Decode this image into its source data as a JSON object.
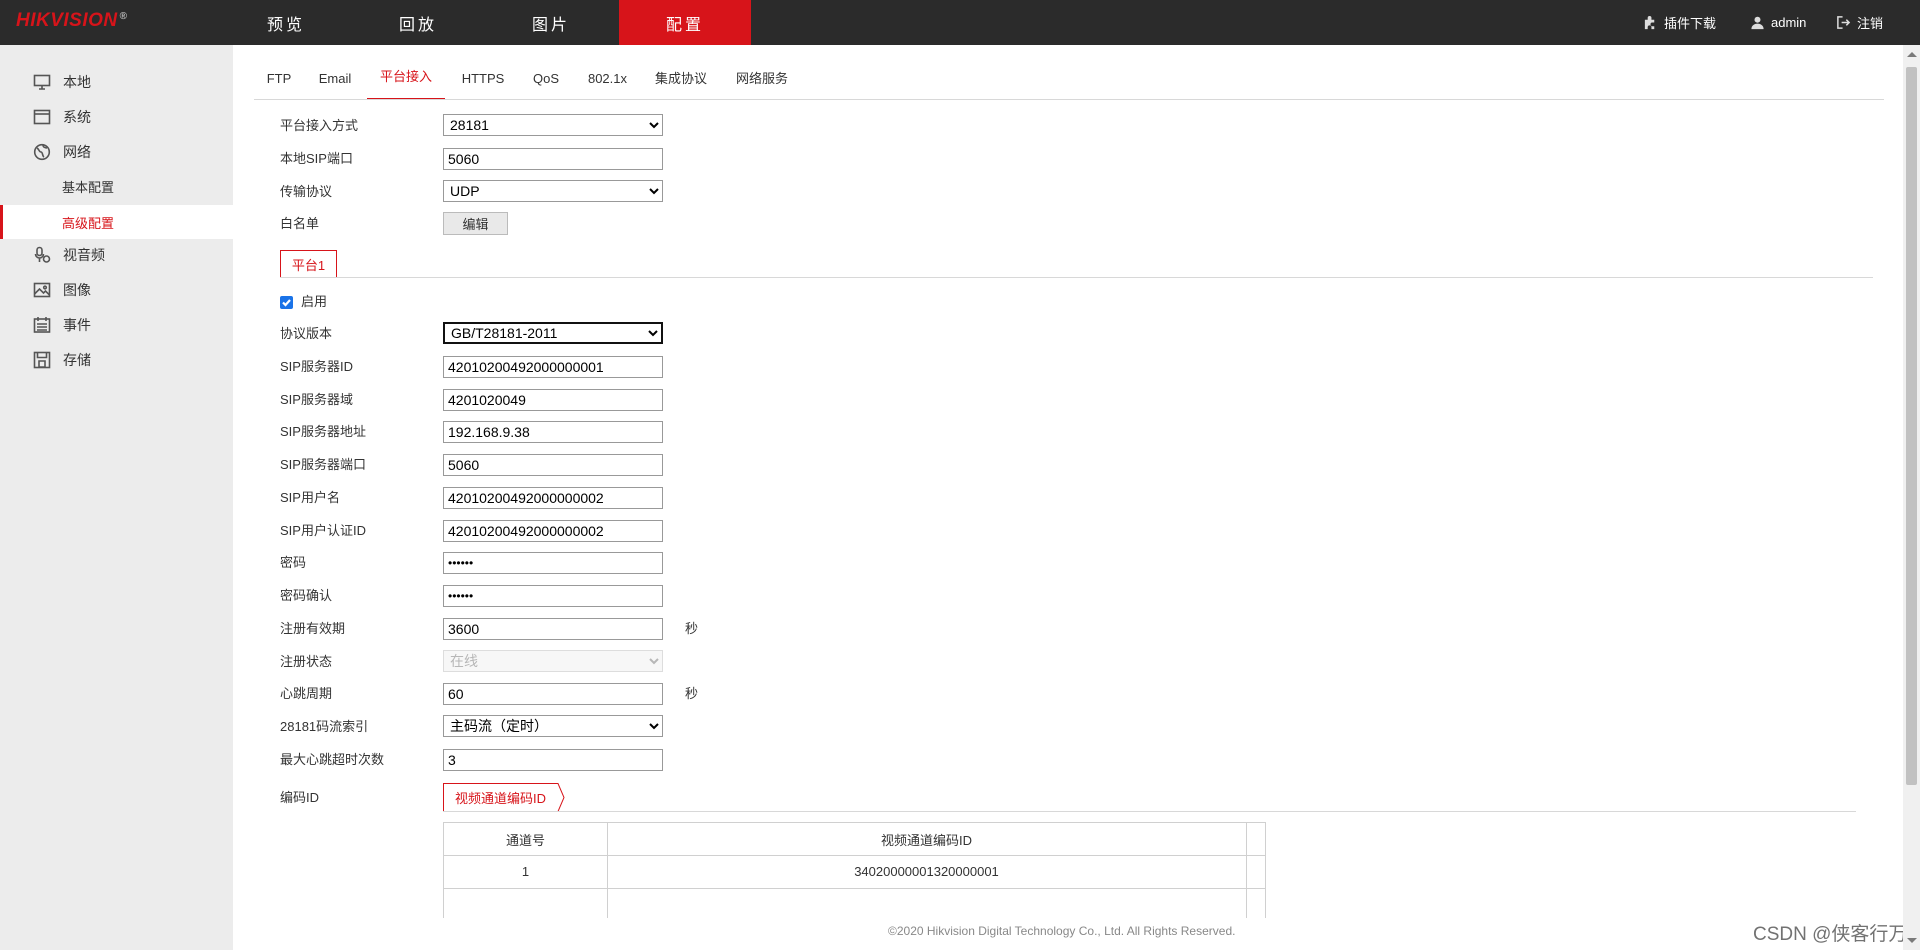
{
  "brand": {
    "logo": "HIKVISION",
    "mark": "®"
  },
  "nav": {
    "tabs": [
      "预览",
      "回放",
      "图片",
      "配置"
    ],
    "active": "配置"
  },
  "topright": {
    "plugin": "插件下载",
    "user": "admin",
    "logout": "注销"
  },
  "sidebar": {
    "items": [
      {
        "label": "本地",
        "icon": "monitor-icon"
      },
      {
        "label": "系统",
        "icon": "window-icon"
      },
      {
        "label": "网络",
        "icon": "globe-icon"
      }
    ],
    "subitems": [
      "基本配置",
      "高级配置"
    ],
    "active_sub": "高级配置",
    "items2": [
      {
        "label": "视音频",
        "icon": "mic-icon"
      },
      {
        "label": "图像",
        "icon": "image-icon"
      },
      {
        "label": "事件",
        "icon": "calendar-icon"
      },
      {
        "label": "存储",
        "icon": "disk-icon"
      }
    ]
  },
  "tabs": [
    "FTP",
    "Email",
    "平台接入",
    "HTTPS",
    "QoS",
    "802.1x",
    "集成协议",
    "网络服务"
  ],
  "active_tab": "平台接入",
  "form": {
    "access_mode": {
      "label": "平台接入方式",
      "value": "28181"
    },
    "local_sip_port": {
      "label": "本地SIP端口",
      "value": "5060"
    },
    "transport": {
      "label": "传输协议",
      "value": "UDP"
    },
    "whitelist": {
      "label": "白名单",
      "button": "编辑"
    }
  },
  "platform_tab": "平台1",
  "platform": {
    "enable": {
      "label": "启用",
      "checked": true
    },
    "protocol_version": {
      "label": "协议版本",
      "value": "GB/T28181-2011"
    },
    "sip_server_id": {
      "label": "SIP服务器ID",
      "value": "42010200492000000001"
    },
    "sip_server_domain": {
      "label": "SIP服务器域",
      "value": "4201020049"
    },
    "sip_server_address": {
      "label": "SIP服务器地址",
      "value": "192.168.9.38"
    },
    "sip_server_port": {
      "label": "SIP服务器端口",
      "value": "5060"
    },
    "sip_username": {
      "label": "SIP用户名",
      "value": "42010200492000000002"
    },
    "sip_auth_id": {
      "label": "SIP用户认证ID",
      "value": "42010200492000000002"
    },
    "password": {
      "label": "密码",
      "value": "••••••"
    },
    "password_confirm": {
      "label": "密码确认",
      "value": "••••••"
    },
    "reg_validity": {
      "label": "注册有效期",
      "value": "3600",
      "unit": "秒"
    },
    "reg_status": {
      "label": "注册状态",
      "value": "在线"
    },
    "heartbeat": {
      "label": "心跳周期",
      "value": "60",
      "unit": "秒"
    },
    "stream_index": {
      "label": "28181码流索引",
      "value": "主码流（定时）"
    },
    "max_heartbeat_timeout": {
      "label": "最大心跳超时次数",
      "value": "3"
    },
    "encoding_id": {
      "label": "编码ID",
      "tab": "视频通道编码ID"
    }
  },
  "table": {
    "headers": [
      "通道号",
      "视频通道编码ID"
    ],
    "rows": [
      [
        "1",
        "34020000001320000001"
      ]
    ]
  },
  "footer": "©2020 Hikvision Digital Technology Co., Ltd. All Rights Reserved.",
  "watermark": "CSDN @侠客行万里",
  "colors": {
    "accent": "#d7141a",
    "topbar": "#2b2b2b",
    "sidebar": "#ececec"
  }
}
